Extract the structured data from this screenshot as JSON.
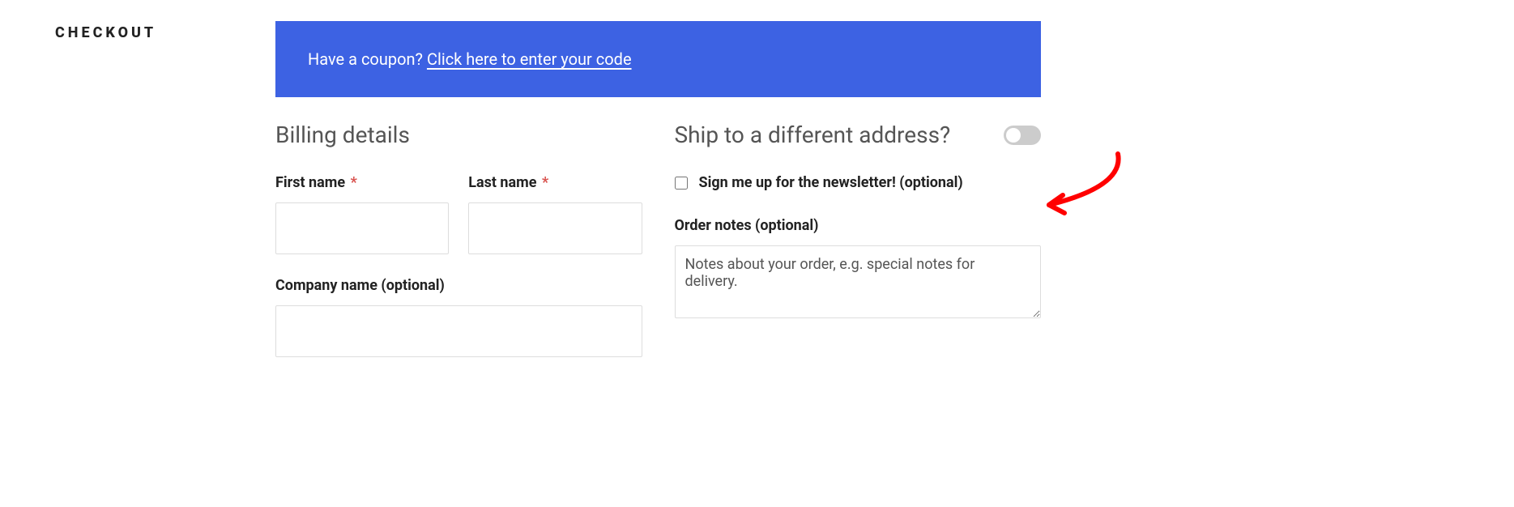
{
  "pageTitle": "CHECKOUT",
  "coupon": {
    "prompt": "Have a coupon? ",
    "link": "Click here to enter your code"
  },
  "billing": {
    "heading": "Billing details",
    "firstName": {
      "label": "First name",
      "required": "*",
      "value": ""
    },
    "lastName": {
      "label": "Last name",
      "required": "*",
      "value": ""
    },
    "companyName": {
      "label": "Company name (optional)",
      "value": ""
    }
  },
  "shipping": {
    "heading": "Ship to a different address?",
    "newsletter": {
      "label": "Sign me up for the newsletter! (optional)"
    },
    "orderNotes": {
      "label": "Order notes (optional)",
      "placeholder": "Notes about your order, e.g. special notes for delivery."
    }
  }
}
